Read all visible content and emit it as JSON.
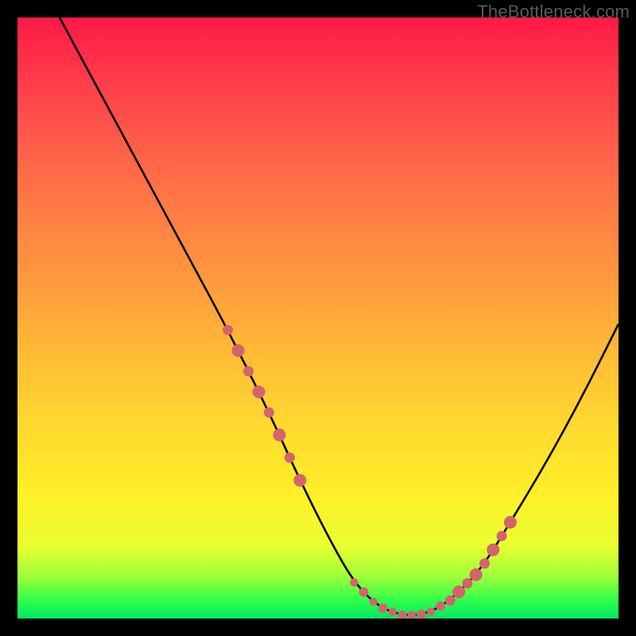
{
  "watermark": "TheBottleneck.com",
  "chart_data": {
    "type": "line",
    "title": "",
    "xlabel": "",
    "ylabel": "",
    "xlim": [
      0,
      100
    ],
    "ylim": [
      0,
      100
    ],
    "series": [
      {
        "name": "curve",
        "color": "#000000",
        "x": [
          7,
          14,
          21,
          28,
          35,
          42,
          47,
          52,
          56,
          60,
          64,
          68,
          72,
          77,
          82,
          88,
          94,
          100
        ],
        "y": [
          100,
          87,
          74,
          61,
          48,
          34,
          23,
          13,
          6,
          2,
          0.5,
          0.7,
          3,
          8,
          16,
          26,
          37,
          49
        ]
      }
    ],
    "annotations": {
      "dotted_segments": {
        "color": "#d4636e",
        "left": {
          "x_range": [
            35,
            47
          ],
          "y_range": [
            48,
            23
          ]
        },
        "bottom": {
          "x_range": [
            56,
            72
          ],
          "y_range": [
            6,
            3
          ]
        },
        "right": {
          "x_range": [
            72,
            82
          ],
          "y_range": [
            3,
            16
          ]
        }
      }
    },
    "background_gradient": {
      "type": "vertical",
      "stops": [
        {
          "pos": 0,
          "color": "#ff1a47"
        },
        {
          "pos": 50,
          "color": "#ffbb36"
        },
        {
          "pos": 80,
          "color": "#fff028"
        },
        {
          "pos": 100,
          "color": "#00e862"
        }
      ]
    }
  }
}
